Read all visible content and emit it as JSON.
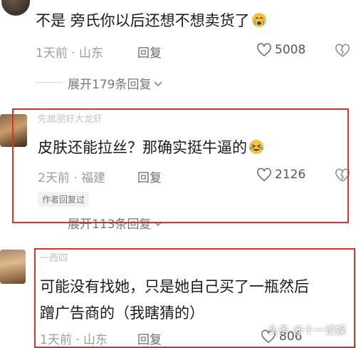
{
  "comments": [
    {
      "username": "",
      "text": "不是 旁氏你以后还想不想卖货了",
      "emoji": "crying-face-icon",
      "time_location": "1天前 · 山东",
      "reply_label": "回复",
      "likes": "5008",
      "expand_label": "展开179条回复"
    },
    {
      "username": "先故朋好大龙虾",
      "text": "皮肤还能拉丝？那确实挺牛逼的",
      "emoji": "laughing-crying-face-icon",
      "time_location": "2天前 · 福建",
      "reply_label": "回复",
      "likes": "2126",
      "author_badge": "作者回复过",
      "expand_label": "展开113条回复"
    },
    {
      "username": "一西四",
      "text_line1": "可能没有找她，只是她自己买了一瓶然后",
      "text_line2": "蹭广告商的（我瞎猜的）",
      "time_location": "1天前 · 山东",
      "reply_label": "回复",
      "likes": "806"
    }
  ],
  "watermark": "头条 @十一谈娱",
  "colors": {
    "highlight_border": "#d8322f",
    "meta_text": "#9b9b9b",
    "emoji_yellow": "#f7c23b"
  }
}
